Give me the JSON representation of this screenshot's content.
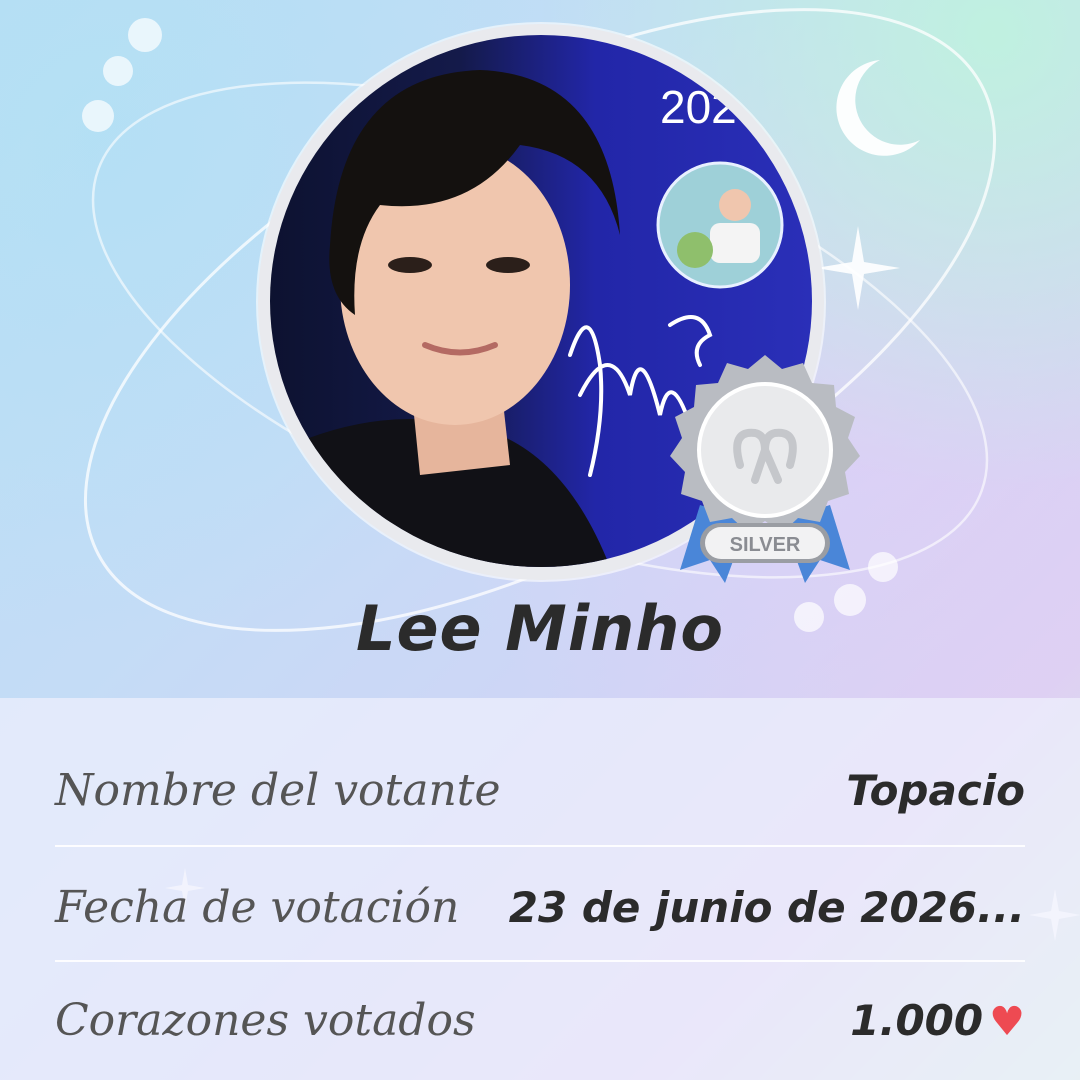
{
  "profile": {
    "name": "Lee Minho",
    "photo_year_text": "202",
    "signature_text": "Lee Minho",
    "badge_label": "SILVER"
  },
  "details": [
    {
      "label": "Nombre del votante",
      "value": "Topacio"
    },
    {
      "label": "Fecha de votación",
      "value": "23 de junio de 2026..."
    },
    {
      "label": "Corazones votados",
      "value": "1.000"
    }
  ],
  "colors": {
    "heart": "#ee4a52",
    "photo_background": "#2a2fb8",
    "badge_ribbon": "#4a86d8"
  },
  "icons": [
    "moon-icon",
    "sparkle-icon",
    "silver-medal-icon",
    "heart-icon"
  ]
}
